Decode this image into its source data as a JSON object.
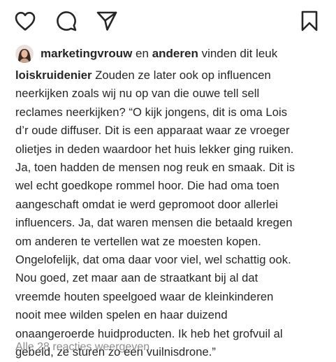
{
  "actions": {
    "like_icon": "heart-icon",
    "comment_icon": "comment-bubble-icon",
    "share_icon": "paper-plane-icon",
    "save_icon": "bookmark-icon"
  },
  "likes": {
    "user": "marketingvrouw",
    "connector": "en",
    "others": "anderen",
    "suffix": "vinden dit leuk"
  },
  "caption": {
    "username": "loiskruidenier",
    "lines": [
      "Zouden ze later ook op influencen",
      "neerkijken zoals wij nu op van die ouwe tell sell",
      "reclames neerkijken? “O kijk jongens, dit is oma Lois",
      "d’r oude diffuser. Dit is een apparaat waar ze vroeger",
      "olietjes in deden waardoor het huis lekker ging ruiken.",
      "Ja, toen hadden de mensen nog reuk en smaak. Dit is",
      "wel echt goedkope rommel hoor. Die had oma toen",
      "aangeschaft omdat ie werd gepromoot door allerlei",
      "influencers. Ja, dat waren mensen die betaald kregen",
      "om anderen te vertellen wat ze moesten kopen.",
      "Ongelofelijk, dat oma daar voor viel, wel schattig ook.",
      "Nou goed, zet maar aan de straatkant bij al dat",
      "vreemde houten speelgoed waar de kleinkinderen",
      "nooit mee wilden spelen en haar duizend",
      "onaangeroerde huidproducten. Ik heb het grofvuil al",
      "gebeld, ze sturen zo een vuilnisdrone.”"
    ]
  },
  "comments_link": "Alle 28 reacties weergeven"
}
